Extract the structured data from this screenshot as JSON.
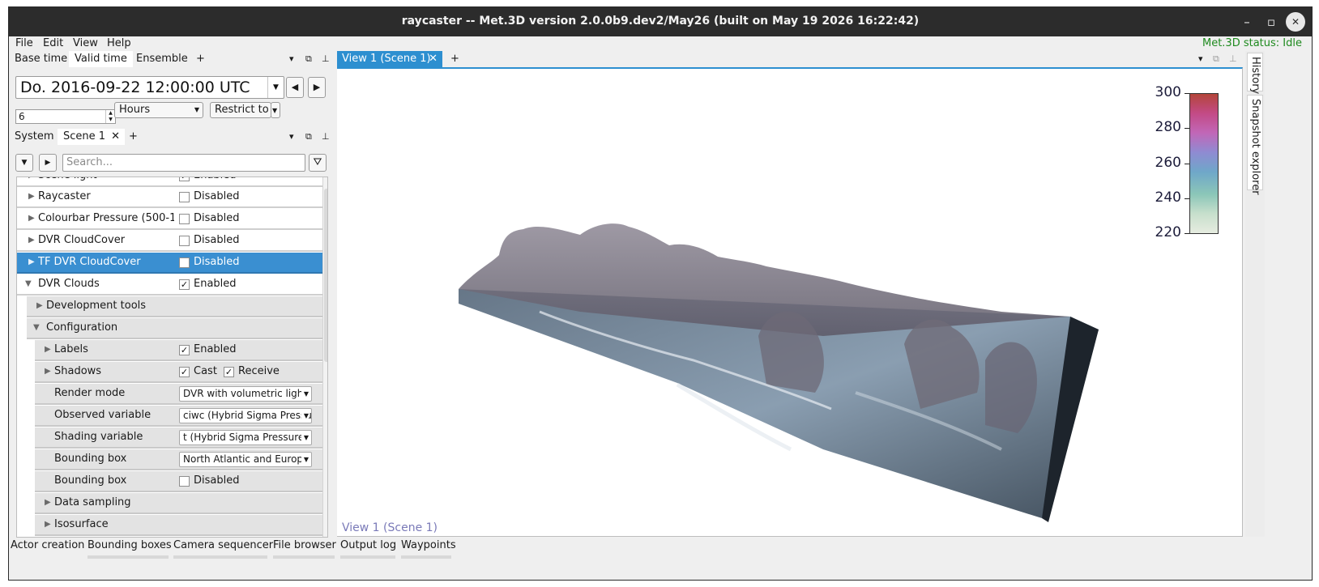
{
  "window": {
    "title": "raycaster -- Met.3D version 2.0.0b9.dev2/May26 (built on May 19 2026 16:22:42)",
    "minimize_label": "–",
    "maximize_label": "▫",
    "close_label": "✕"
  },
  "menu": {
    "file": "File",
    "edit": "Edit",
    "view": "View",
    "help": "Help",
    "status": "Met.3D status: Idle"
  },
  "time_dock": {
    "tabs": [
      "Base time",
      "Valid time",
      "Ensemble"
    ],
    "add_label": "+",
    "active_tab": "Valid time",
    "date_value": "Do. 2016-09-22 12:00:00 UTC",
    "step_value": "6",
    "step_unit": "Hours",
    "restrict_label": "Restrict to"
  },
  "scene_dock": {
    "tabs": [
      "System",
      "Scene 1"
    ],
    "add_label": "+",
    "search_placeholder": "Search..."
  },
  "tree": {
    "rows": [
      {
        "label": "Scene light",
        "value": "Enabled",
        "checked": true
      },
      {
        "label": "Raycaster",
        "value": "Disabled",
        "checked": false
      },
      {
        "label": "Colourbar Pressure (500-1...",
        "value": "Disabled",
        "checked": false
      },
      {
        "label": "DVR CloudCover",
        "value": "Disabled",
        "checked": false
      },
      {
        "label": "TF DVR CloudCover",
        "value": "Disabled",
        "checked": false
      },
      {
        "label": "DVR Clouds",
        "value": "Enabled",
        "checked": true
      },
      {
        "label": "Development tools"
      },
      {
        "label": "Configuration"
      },
      {
        "label": "Labels",
        "value": "Enabled",
        "checked": true
      },
      {
        "label": "Shadows",
        "cast": "Cast",
        "receive": "Receive"
      },
      {
        "label": "Render mode",
        "value": "DVR with volumetric light"
      },
      {
        "label": "Observed variable",
        "value": "ciwc (Hybrid Sigma Pressure)"
      },
      {
        "label": "Shading variable",
        "value": "t (Hybrid Sigma Pressure)"
      },
      {
        "label": "Bounding box",
        "value": "North Atlantic and Europe"
      },
      {
        "label": "Bounding box",
        "value": "Disabled",
        "checked": false
      },
      {
        "label": "Data sampling"
      },
      {
        "label": "Isosurface"
      }
    ]
  },
  "view": {
    "tab_label": "View 1 (Scene 1)",
    "add_label": "+",
    "overlay_label": "View 1 (Scene 1)",
    "colorbar_ticks": [
      "300",
      "280",
      "260",
      "240",
      "220"
    ]
  },
  "right_sidebar": {
    "tabs": [
      "History",
      "Snapshot explorer"
    ]
  },
  "bottom_tabs": [
    "Actor creation",
    "Bounding boxes",
    "Camera sequencer",
    "File browser",
    "Output log",
    "Waypoints"
  ]
}
